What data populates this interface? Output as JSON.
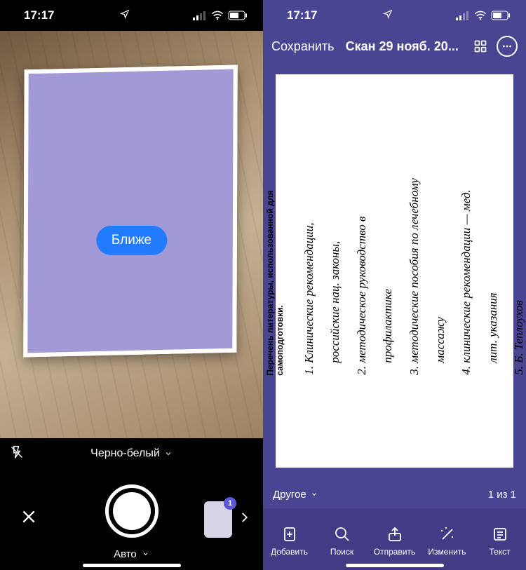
{
  "status": {
    "time": "17:17",
    "signal_icon": "cell-signal-icon",
    "wifi_icon": "wifi-icon",
    "battery_icon": "battery-icon"
  },
  "left": {
    "hint": "Ближе",
    "flash_icon": "flash-off-icon",
    "color_mode": "Черно-белый",
    "close_icon": "close-icon",
    "shutter_icon": "shutter-button",
    "thumb_count": "1",
    "next_icon": "chevron-right-icon",
    "auto_label": "Авто",
    "home_indicator": "home-indicator"
  },
  "right": {
    "save_label": "Сохранить",
    "title": "Скан 29 нояб. 20...",
    "grid_icon": "grid-icon",
    "more_icon": "more-icon",
    "doc_heading": "Перечень литературы, использованной для самоподготовки.",
    "doc_items": [
      "Клинические рекомендации, российские нац. законы,",
      "методическое руководство в профилактике",
      "методические пособия по лечебному массажу",
      "клинические рекомендации — мед. лит. указания",
      "Б. Теплоухов"
    ],
    "category_label": "Другое",
    "page_counter": "1 из 1",
    "tools": {
      "add": {
        "label": "Добавить",
        "icon": "add-page-icon"
      },
      "search": {
        "label": "Поиск",
        "icon": "search-icon"
      },
      "send": {
        "label": "Отправить",
        "icon": "share-icon"
      },
      "edit": {
        "label": "Изменить",
        "icon": "wand-icon"
      },
      "text": {
        "label": "Текст",
        "icon": "text-icon"
      }
    }
  }
}
